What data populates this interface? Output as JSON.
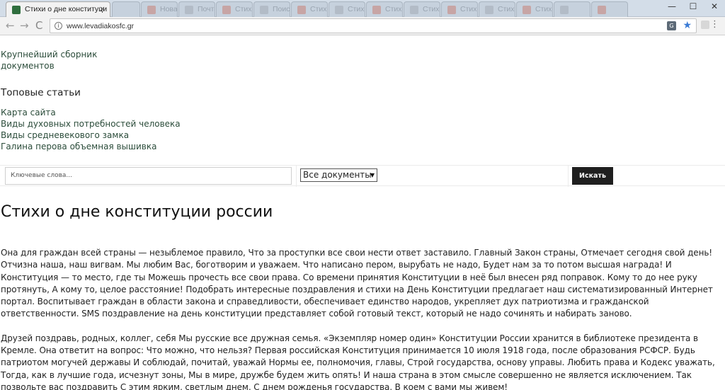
{
  "browser": {
    "active_tab": {
      "title": "Стихи о дне конституци",
      "close": "×"
    },
    "other_tabs": [
      "",
      "Новая вкладка",
      "Почта",
      "Стихи о дне",
      "Поиск",
      "Стихи",
      "Стихи",
      "Стихи о",
      "Стихи",
      "Стихи",
      "Стихи",
      "Стихи"
    ],
    "window_controls": {
      "minimize": "—",
      "maximize": "☐",
      "close": "✕"
    },
    "nav": {
      "back": "←",
      "forward": "→",
      "reload": "C"
    },
    "url": "www.levadiakosfc.gr",
    "info_glyph": "i",
    "translate_glyph": "G",
    "bookmark_glyph": "★",
    "menu_glyph": "⋮"
  },
  "sidebar": {
    "collection_links": [
      "Крупнейший сборник",
      "документов"
    ],
    "top_articles_heading": "Топовые статьи",
    "top_articles": [
      "Карта сайта",
      "Виды духовных потребностей человека",
      "Виды средневекового замка",
      "Галина перова объемная вышивка"
    ]
  },
  "search": {
    "placeholder": "Ключевые слова...",
    "select_value": "Все документы",
    "select_arrow": "▼",
    "button": "Искать"
  },
  "article": {
    "title": "Стихи о дне конституции россии",
    "paragraphs": [
      "Она для граждан всей страны — незыблемое правило, Что за проступки все свои нести ответ заставило. Главный Закон страны, Отмечает сегодня свой день! Отчизна наша, наш вигвам. Мы любим Вас, боготворим и уважаем. Что написано пером, вырубать не надо, Будет нам за то потом высшая награда! И Конституция — то место, где ты Можешь прочесть все свои права. Со времени принятия Конституции в неё был внесен ряд поправок. Кому то до нее руку протянуть, А кому то, целое расстояние! Подобрать интересные поздравления и стихи на День Конституции предлагает наш систематизированный Интернет портал. Воспитывает граждан в области закона и справедливости, обеспечивает единство народов, укрепляет дух патриотизма и гражданской ответственности. SMS поздравление на день конституции представляет собой готовый текст, который не надо сочинять и набирать заново.",
      "Друзей поздравь, родных, коллег, себя Мы русские все дружная семья. «Экземпляр номер один» Конституции России хранится в библиотеке президента в Кремле. Она ответит на вопрос: Что можно, что нельзя? Первая российская Конституция принимается 10 июля 1918 года, после образования РСФСР. Будь патриотом могучей державы И соблюдай, почитай, уважай Нормы ее, полномочия, главы, Строй государства, основу управы. Любить права и Кодекс уважать, Тогда, как в лучшие года, исчезнут зоны, Мы в мире, дружбе будем жить опять! И наша страна в этом смысле совершенно не является исключением. Так позвольте вас поздравить С этим ярким, светлым днем, С днем рожденья государства, В коем с вами мы живем!"
    ]
  }
}
